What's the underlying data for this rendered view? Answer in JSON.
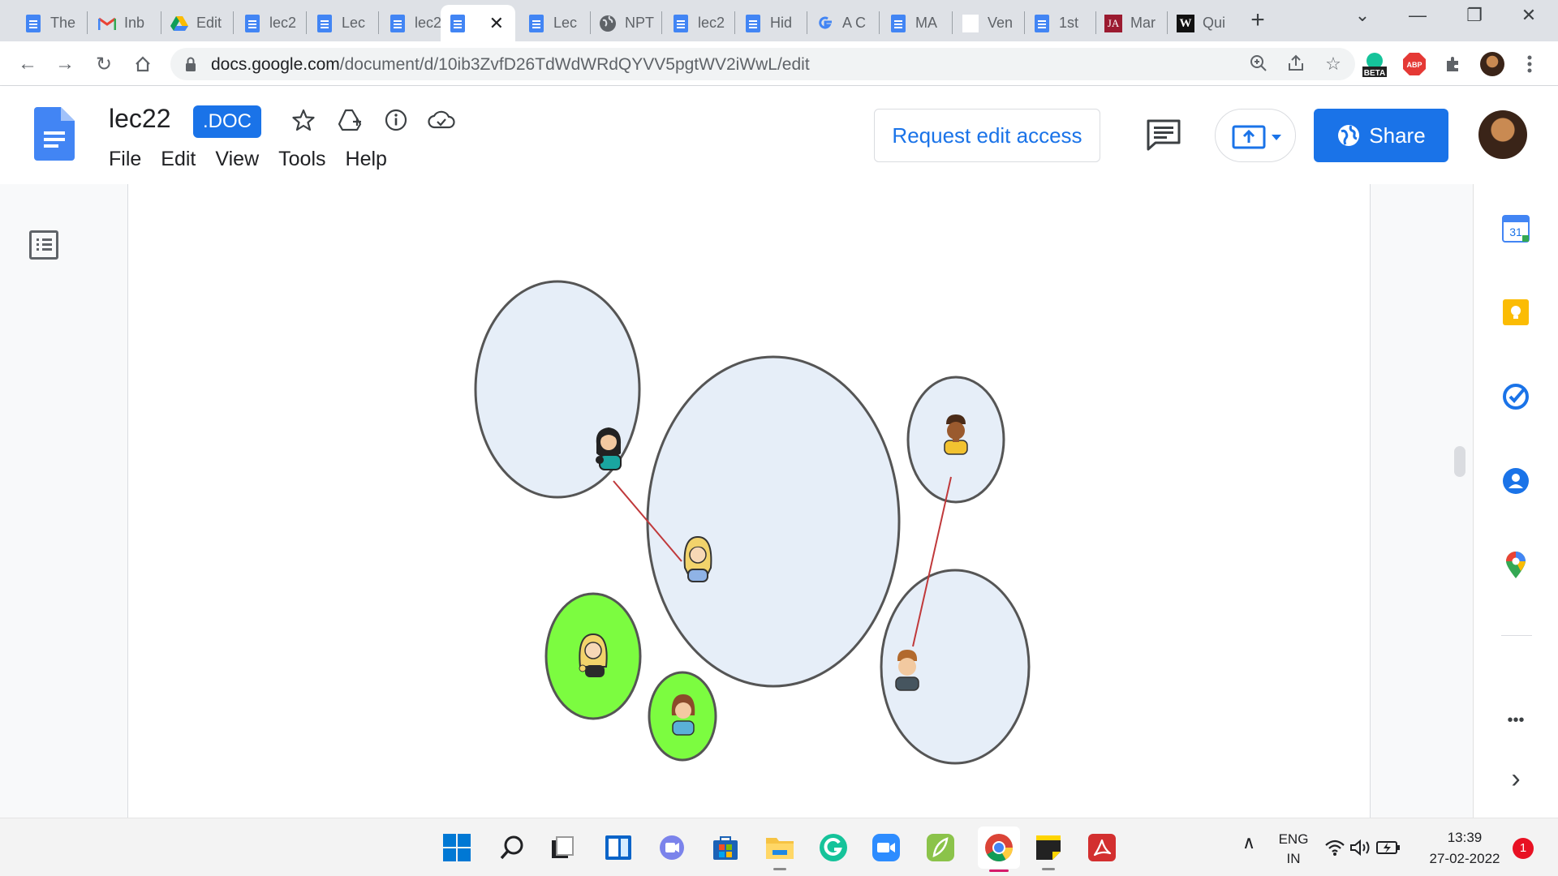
{
  "browser": {
    "tabs": [
      {
        "label": "The",
        "icon": "docs-icon"
      },
      {
        "label": "Inb",
        "icon": "gmail-icon"
      },
      {
        "label": "Edit",
        "icon": "drive-icon"
      },
      {
        "label": "lec2",
        "icon": "docs-icon"
      },
      {
        "label": "Lec",
        "icon": "docs-icon"
      },
      {
        "label": "lec2",
        "icon": "docs-icon"
      },
      {
        "label": "",
        "icon": "docs-icon",
        "active": true
      },
      {
        "label": "Lec",
        "icon": "docs-icon"
      },
      {
        "label": "NPT",
        "icon": "globe-icon"
      },
      {
        "label": "lec2",
        "icon": "docs-icon"
      },
      {
        "label": "Hid",
        "icon": "docs-icon"
      },
      {
        "label": "A C",
        "icon": "google-icon"
      },
      {
        "label": "MA",
        "icon": "docs-icon"
      },
      {
        "label": "Ven",
        "icon": "blank-page-icon"
      },
      {
        "label": "1st",
        "icon": "docs-icon"
      },
      {
        "label": "Mar",
        "icon": "ja-icon"
      },
      {
        "label": "Qui",
        "icon": "w-icon"
      }
    ],
    "close_tab_glyph": "✕",
    "new_tab_glyph": "+",
    "url_host": "docs.google.com",
    "url_path": "/document/d/10ib3ZvfD26TdWdWRdQYVV5pgtWV2iWwL/edit",
    "beta_badge": "BETA",
    "abp_badge": "ABP"
  },
  "docs": {
    "title": "lec22",
    "format_badge": ".DOC",
    "menu": [
      "File",
      "Edit",
      "View",
      "Tools",
      "Help"
    ],
    "request_edit_label": "Request edit access",
    "share_label": "Share"
  },
  "side_panel": {
    "calendar_day": "31",
    "more_glyph": "•••",
    "expand_glyph": "›"
  },
  "diagram": {
    "colors": {
      "group_fill": "#e6eef8",
      "group_stroke": "#555555",
      "highlight_fill": "#7cfc40",
      "link": "#c0393b"
    },
    "people": [
      "woman-dark-hair-icon",
      "woman-blonde-icon",
      "man-dark-skin-icon",
      "woman-blonde-curly-icon",
      "girl-brown-hair-icon",
      "man-brown-hair-icon"
    ]
  },
  "taskbar": {
    "apps": [
      "windows-start-icon",
      "search-icon",
      "task-view-icon",
      "widgets-icon",
      "teams-chat-icon",
      "store-icon",
      "file-explorer-icon",
      "grammarly-icon",
      "zoom-icon",
      "feather-app-icon",
      "chrome-icon",
      "sticky-notes-icon",
      "acrobat-icon"
    ],
    "lang_top": "ENG",
    "lang_bottom": "IN",
    "time": "13:39",
    "date": "27-02-2022",
    "notifications": "1",
    "tray_chevron": "∧"
  }
}
